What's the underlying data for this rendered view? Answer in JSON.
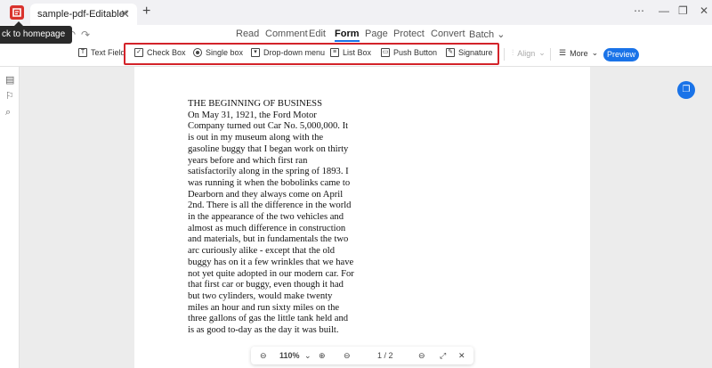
{
  "titlebar": {
    "tab_title": "sample-pdf-Editable*",
    "tab_close": "✕",
    "new_tab": "+",
    "more": "⋯",
    "minimize": "—",
    "restore": "❐",
    "close": "✕"
  },
  "tooltip": "ck to homepage",
  "menu": {
    "items": [
      {
        "label": "Read"
      },
      {
        "label": "Comment"
      },
      {
        "label": "Edit"
      },
      {
        "label": "Form"
      },
      {
        "label": "Page"
      },
      {
        "label": "Protect"
      },
      {
        "label": "Convert"
      },
      {
        "label": "Batch"
      }
    ],
    "active": "Form"
  },
  "toolbar": {
    "text_field": "Text Field",
    "check_box": "Check Box",
    "single_box": "Single box",
    "dropdown_menu": "Drop-down menu",
    "list_box": "List Box",
    "push_button": "Push Button",
    "signature": "Signature",
    "align": "Align",
    "more": "More",
    "preview": "Preview"
  },
  "document": {
    "lines": [
      "THE BEGINNING OF BUSINESS",
      "On May 31, 1921, the Ford Motor",
      "Company turned out Car No. 5,000,000. It",
      "is out in my museum along with the",
      "gasoline buggy that I began work on thirty",
      "years before and which first ran",
      "satisfactorily along in the spring of 1893. I",
      "was running it when the bobolinks came to",
      "Dearborn and they always come on April",
      "2nd. There is all the difference in the world",
      "in the appearance of the two vehicles and",
      "almost as much difference in construction",
      "and materials, but in fundamentals the two",
      "arc curiously alike - except that the old",
      "buggy has on it a few wrinkles that we have",
      "not yet quite adopted in our modern car. For",
      "that first car or buggy, even though it had",
      "but two cylinders, would make twenty",
      "miles an hour and run sixty miles on the",
      "three gallons of gas the little tank held and",
      "is as good to-day as the day it was built."
    ]
  },
  "zoom": {
    "level": "110%",
    "page_indicator": "1 / 2"
  },
  "colors": {
    "accent": "#1a73e8",
    "highlight": "#d3232a"
  }
}
